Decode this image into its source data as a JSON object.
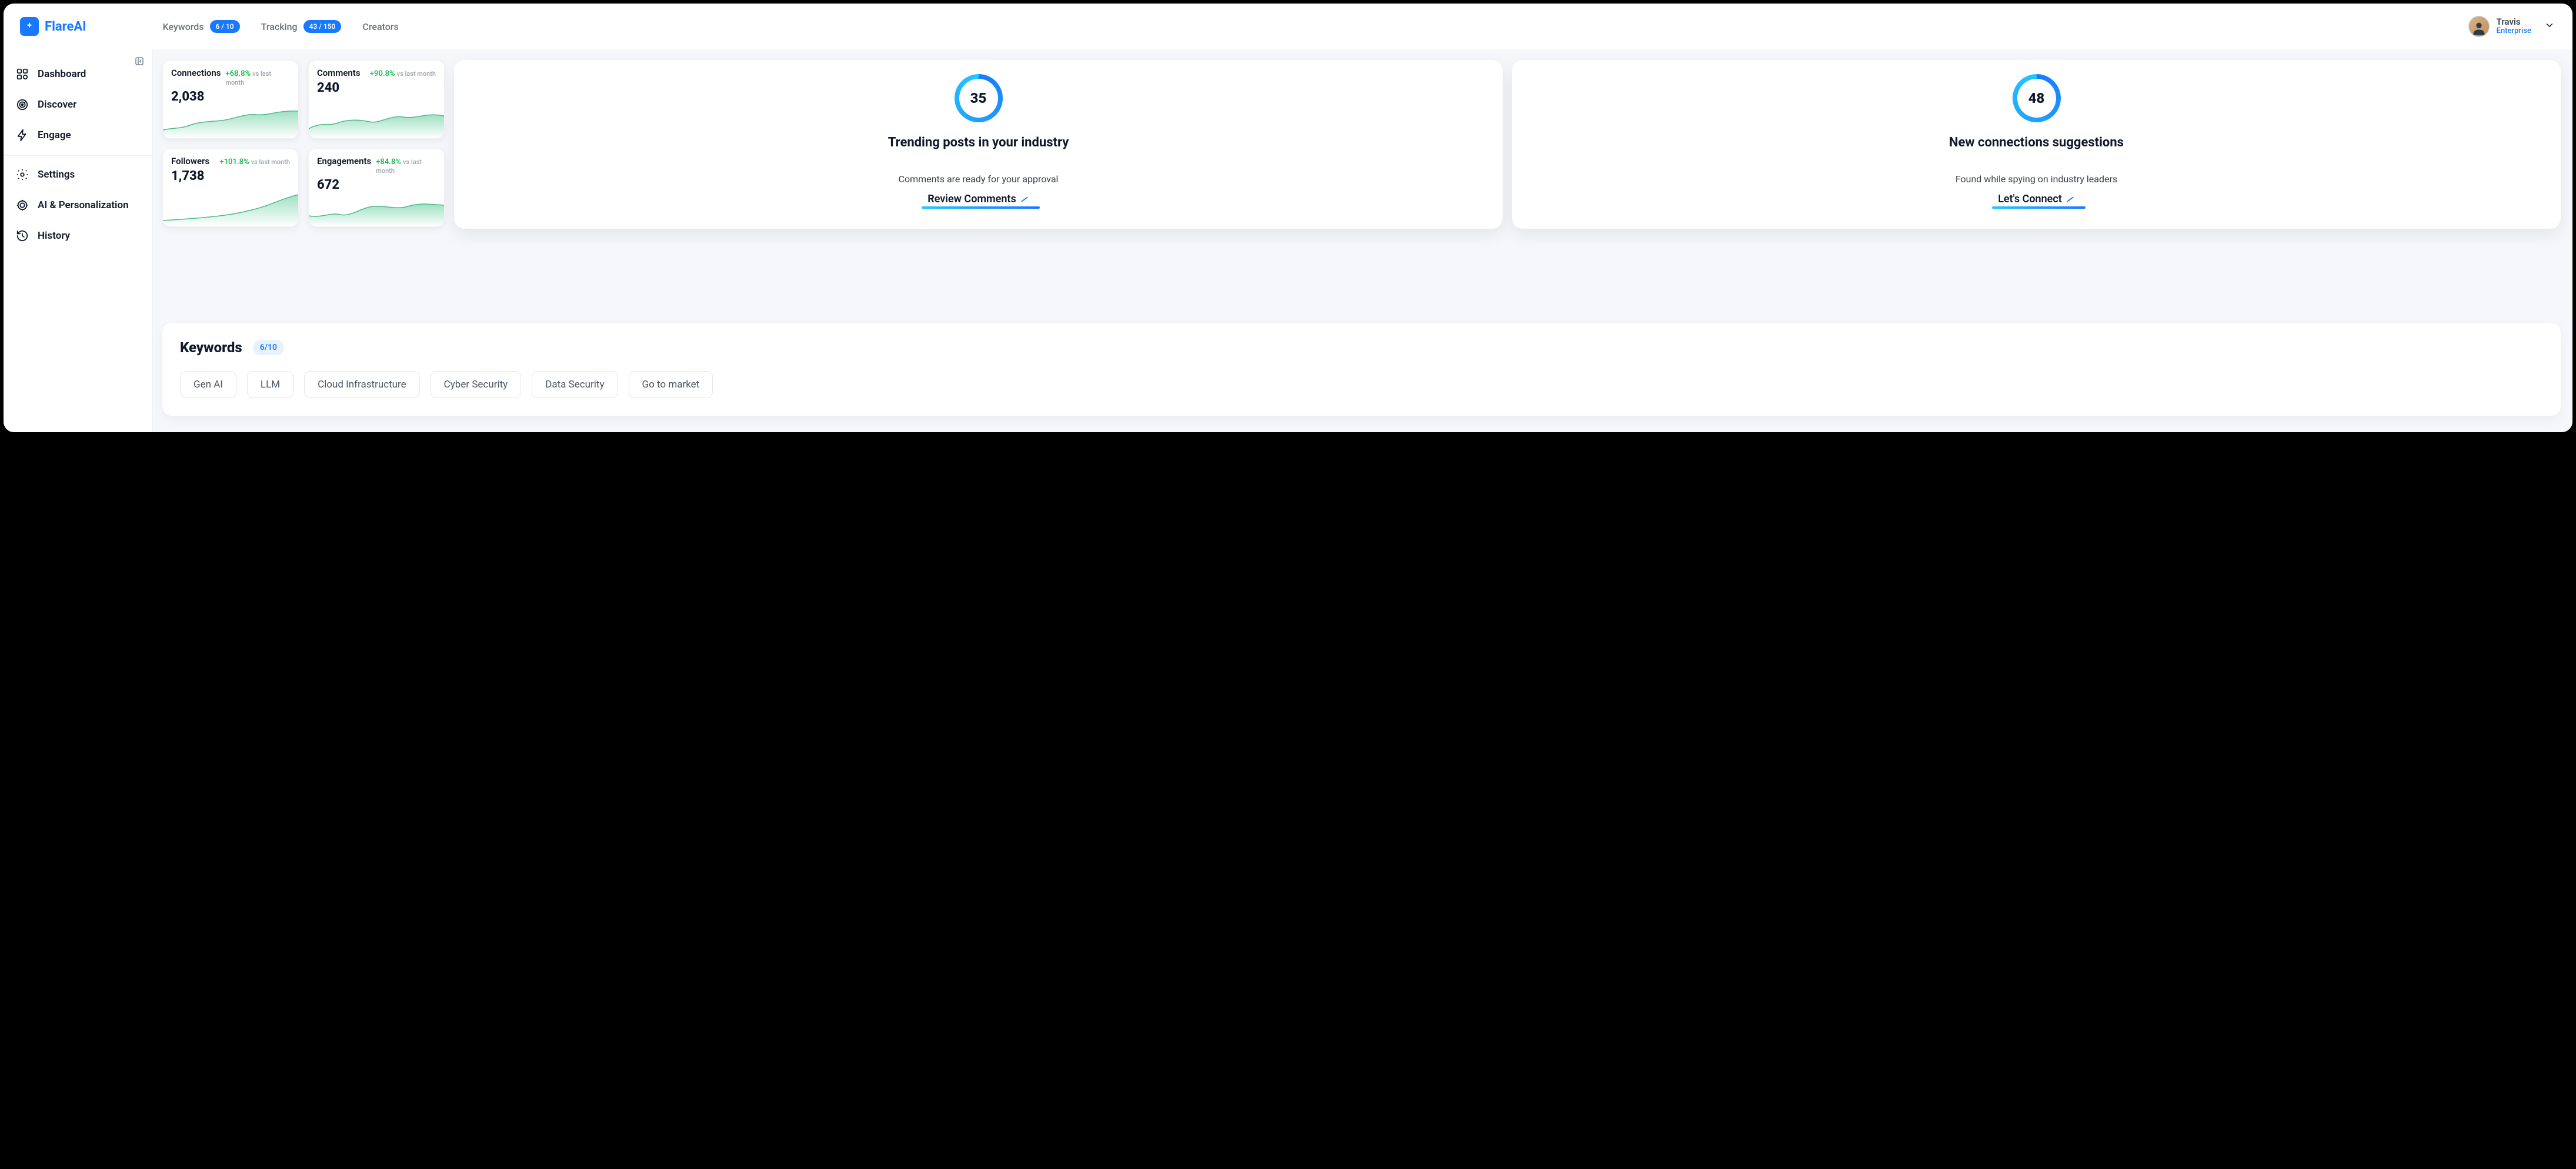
{
  "brand": {
    "name": "FlareAI"
  },
  "nav": {
    "keywords_label": "Keywords",
    "keywords_badge": "6 / 10",
    "tracking_label": "Tracking",
    "tracking_badge": "43 / 150",
    "creators_label": "Creators"
  },
  "user": {
    "name": "Travis",
    "plan": "Enterprise"
  },
  "sidebar": {
    "dashboard": "Dashboard",
    "discover": "Discover",
    "engage": "Engage",
    "settings": "Settings",
    "ai": "AI & Personalization",
    "history": "History"
  },
  "stats": {
    "vs_label": "vs last month",
    "connections": {
      "title": "Connections",
      "delta": "+68.8%",
      "value": "2,038"
    },
    "comments": {
      "title": "Comments",
      "delta": "+90.8%",
      "value": "240"
    },
    "followers": {
      "title": "Followers",
      "delta": "+101.8%",
      "value": "1,738"
    },
    "engagements": {
      "title": "Engagements",
      "delta": "+84.8%",
      "value": "672"
    }
  },
  "trending": {
    "count": "35",
    "title": "Trending posts in your industry",
    "subtitle": "Comments are ready for your approval",
    "cta": "Review Comments"
  },
  "suggestions": {
    "count": "48",
    "title": "New connections suggestions",
    "subtitle": "Found while spying on industry leaders",
    "cta": "Let's Connect"
  },
  "keywords_panel": {
    "title": "Keywords",
    "count": "6/10",
    "chips": [
      "Gen AI",
      "LLM",
      "Cloud Infrastructure",
      "Cyber Security",
      "Data Security",
      "Go to market"
    ]
  },
  "chart_data": [
    {
      "type": "area",
      "title": "Connections sparkline",
      "x": [
        0,
        1,
        2,
        3,
        4,
        5,
        6,
        7,
        8,
        9
      ],
      "values": [
        8,
        12,
        10,
        17,
        15,
        24,
        22,
        30,
        28,
        32
      ]
    },
    {
      "type": "area",
      "title": "Comments sparkline",
      "x": [
        0,
        1,
        2,
        3,
        4,
        5,
        6,
        7,
        8,
        9
      ],
      "values": [
        10,
        18,
        14,
        22,
        18,
        26,
        22,
        28,
        24,
        26
      ]
    },
    {
      "type": "area",
      "title": "Followers sparkline",
      "x": [
        0,
        1,
        2,
        3,
        4,
        5,
        6,
        7,
        8,
        9
      ],
      "values": [
        6,
        8,
        9,
        10,
        12,
        14,
        16,
        22,
        32,
        48
      ]
    },
    {
      "type": "area",
      "title": "Engagements sparkline",
      "x": [
        0,
        1,
        2,
        3,
        4,
        5,
        6,
        7,
        8,
        9
      ],
      "values": [
        14,
        12,
        18,
        14,
        22,
        26,
        22,
        28,
        24,
        26
      ]
    }
  ]
}
